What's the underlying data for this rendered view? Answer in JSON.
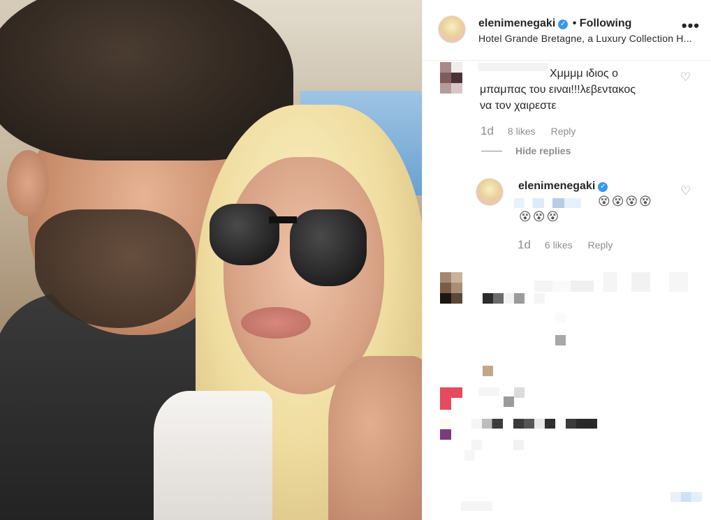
{
  "post": {
    "username": "elenimenegaki",
    "follow_status": "Following",
    "location": "Hotel Grande Bretagne, a Luxury Collection H..."
  },
  "comments": [
    {
      "text_line1": "Χμμμμ ιδιος ο",
      "text_line2": "μπαμπας του ειναι!!!λεβεντακος",
      "text_line3": "να τον χαιρεστε",
      "age": "1d",
      "likes": "8 likes",
      "reply_label": "Reply",
      "hide_replies": "Hide replies",
      "reply": {
        "username": "elenimenegaki",
        "emoji_line1": "😵😵😵😵",
        "emoji_line2": "😵😵😵",
        "age": "1d",
        "likes": "6 likes",
        "reply_label": "Reply"
      }
    }
  ],
  "icons": {
    "verified": "verified-badge",
    "more": "more-options-icon",
    "heart": "heart-icon"
  },
  "colors": {
    "verified": "#3897f0",
    "meta_text": "#8e8e8e",
    "text": "#262626"
  }
}
